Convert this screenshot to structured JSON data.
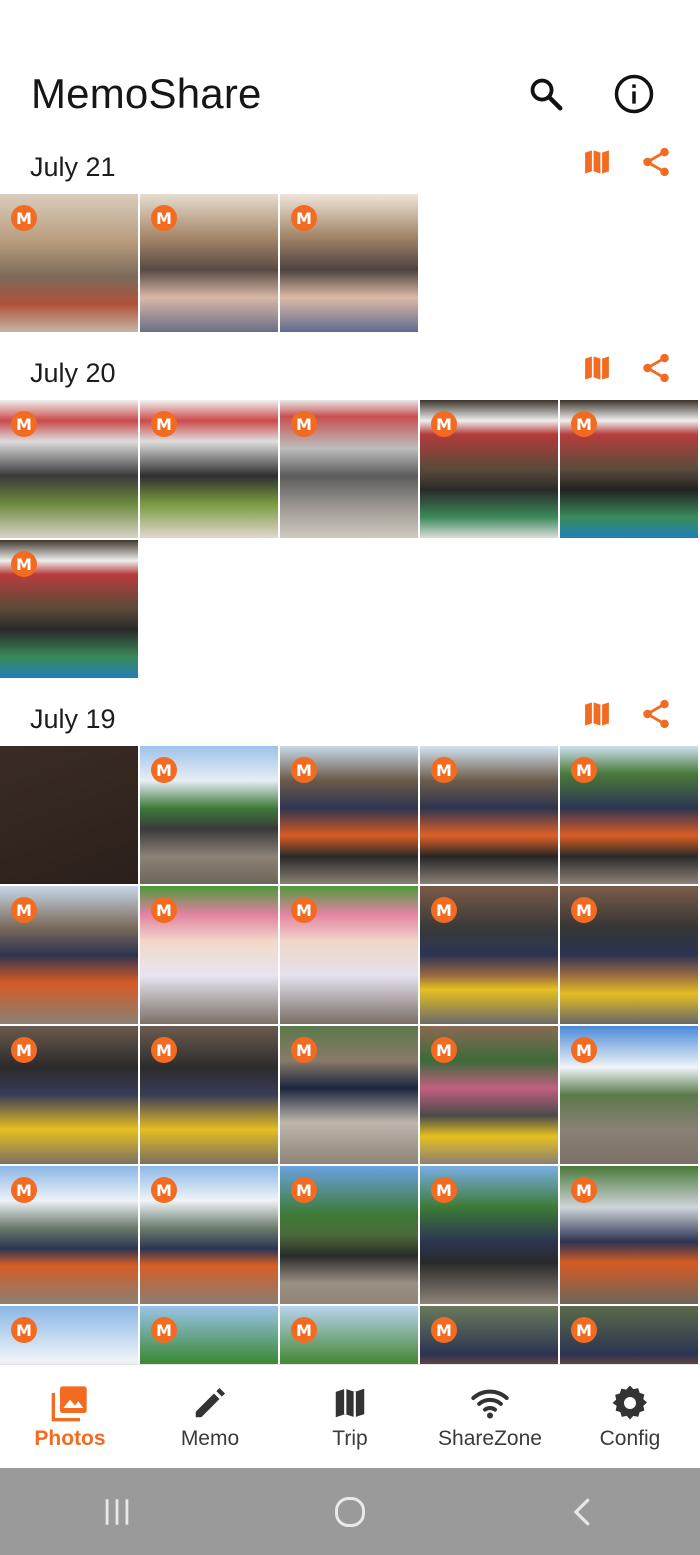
{
  "app": {
    "title": "MemoShare",
    "accent_color": "#f26b21"
  },
  "header": {
    "search_icon": "search-icon",
    "info_icon": "info-icon"
  },
  "sections": [
    {
      "date": "July 21",
      "photo_count": 3,
      "badge": "M"
    },
    {
      "date": "July 20",
      "photo_count": 6,
      "badge": "M"
    },
    {
      "date": "July 19",
      "photo_count": 25,
      "badge": "M"
    }
  ],
  "section_actions": {
    "map_icon": "map-icon",
    "share_icon": "share-icon"
  },
  "bottom_nav": [
    {
      "label": "Photos",
      "icon": "photos-icon",
      "active": true
    },
    {
      "label": "Memo",
      "icon": "pencil-icon",
      "active": false
    },
    {
      "label": "Trip",
      "icon": "map-icon",
      "active": false
    },
    {
      "label": "ShareZone",
      "icon": "wifi-icon",
      "active": false
    },
    {
      "label": "Config",
      "icon": "gear-icon",
      "active": false
    }
  ],
  "system_nav": [
    "recents-button",
    "home-button",
    "back-button"
  ]
}
